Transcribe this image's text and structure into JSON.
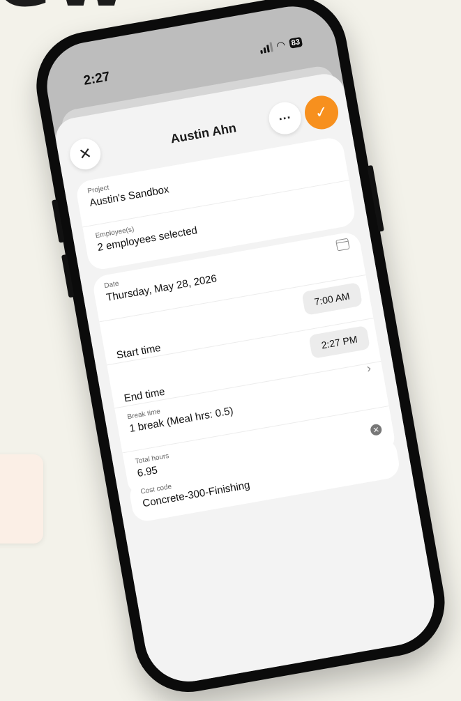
{
  "headline": "ew",
  "status": {
    "time": "2:27",
    "battery": "83"
  },
  "header": {
    "title": "Austin Ahn",
    "more_glyph": "···",
    "confirm_glyph": "✓",
    "close_glyph": "✕"
  },
  "project": {
    "label": "Project",
    "value": "Austin's Sandbox"
  },
  "employees": {
    "label": "Employee(s)",
    "value": "2 employees selected"
  },
  "date": {
    "label": "Date",
    "value": "Thursday, May 28, 2026"
  },
  "start_time": {
    "label": "Start time",
    "value": "7:00 AM"
  },
  "end_time": {
    "label": "End time",
    "value": "2:27 PM"
  },
  "break_time": {
    "label": "Break time",
    "value": "1 break (Meal hrs: 0.5)"
  },
  "total_hours": {
    "label": "Total hours",
    "value": "6.95"
  },
  "cost_code": {
    "label": "Cost code",
    "value": "Concrete-300-Finishing"
  },
  "icons": [
    "close-icon",
    "more-icon",
    "check-icon",
    "calendar-icon",
    "chevron-right-icon",
    "clear-icon",
    "signal-icon",
    "wifi-icon",
    "battery-icon"
  ],
  "colors": {
    "accent": "#f7901e",
    "background": "#f3f2ea"
  }
}
